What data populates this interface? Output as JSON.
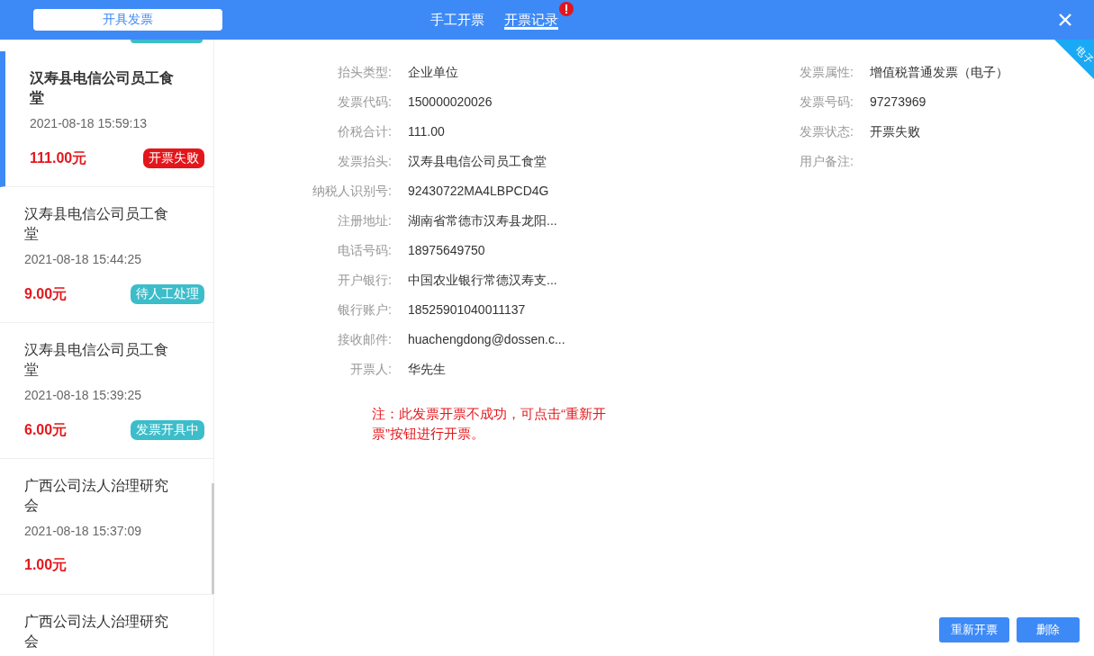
{
  "header": {
    "issue_button": "开具发票",
    "tabs": [
      {
        "label": "手工开票",
        "selected": false,
        "alert": false
      },
      {
        "label": "开票记录",
        "selected": true,
        "alert": true
      }
    ]
  },
  "corner_ribbon": "电子",
  "records": [
    {
      "title": "汉寿县电信公司员工食堂",
      "time": "2021-08-18 15:59:13",
      "amount": "111.00元",
      "status": "开票失败",
      "color": "#e3161b",
      "selected": true
    },
    {
      "title": "汉寿县电信公司员工食堂",
      "time": "2021-08-18 15:44:25",
      "amount": "9.00元",
      "status": "待人工处理",
      "color": "#3cbdca",
      "selected": false
    },
    {
      "title": "汉寿县电信公司员工食堂",
      "time": "2021-08-18 15:39:25",
      "amount": "6.00元",
      "status": "发票开具中",
      "color": "#3cbdca",
      "selected": false
    },
    {
      "title": "广西公司法人治理研究会",
      "time": "2021-08-18 15:37:09",
      "amount": "1.00元",
      "selected": false
    },
    {
      "title": "广西公司法人治理研究会",
      "selected": false
    }
  ],
  "detail": {
    "left_fields": [
      {
        "label": "抬头类型:",
        "value": "企业单位"
      },
      {
        "label": "发票代码:",
        "value": "150000020026"
      },
      {
        "label": "价税合计:",
        "value": "111.00"
      },
      {
        "label": "发票抬头:",
        "value": "汉寿县电信公司员工食堂"
      },
      {
        "label": "纳税人识别号:",
        "value": "92430722MA4LBPCD4G"
      },
      {
        "label": "注册地址:",
        "value": "湖南省常德市汉寿县龙阳..."
      },
      {
        "label": "电话号码:",
        "value": "18975649750"
      },
      {
        "label": "开户银行:",
        "value": "中国农业银行常德汉寿支..."
      },
      {
        "label": "银行账户:",
        "value": "18525901040011137"
      },
      {
        "label": "接收邮件:",
        "value": "huachengdong@dossen.c..."
      },
      {
        "label": "开票人:",
        "value": "华先生"
      }
    ],
    "right_fields": [
      {
        "label": "发票属性:",
        "value": "增值税普通发票（电子）"
      },
      {
        "label": "发票号码:",
        "value": "97273969"
      },
      {
        "label": "发票状态:",
        "value": "开票失败"
      },
      {
        "label": "用户备注:"
      }
    ],
    "note": "注：此发票开票不成功，可点击“重新开票”按钮进行开票。",
    "buttons": [
      "重新开票",
      "删除"
    ]
  }
}
